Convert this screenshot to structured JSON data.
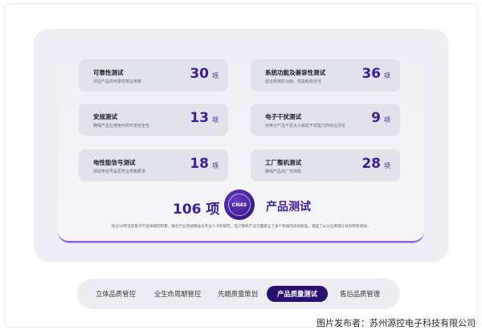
{
  "cards": [
    {
      "title": "可靠性测试",
      "desc": "评估产品的可靠性特征参数",
      "count": "30",
      "unit": "项"
    },
    {
      "title": "系统功能及兼容性测试",
      "desc": "验证系统的功能、性能和稳定性",
      "count": "36",
      "unit": "项"
    },
    {
      "title": "安规测试",
      "desc": "确保产品在使用中的环境安全性",
      "count": "13",
      "unit": "项"
    },
    {
      "title": "电子干扰测试",
      "desc": "对电子产品干扰大小和抗干扰能力的综合评定",
      "count": "9",
      "unit": "项"
    },
    {
      "title": "电性能信号测试",
      "desc": "测试电信号是否符合规格要求",
      "count": "18",
      "unit": "项"
    },
    {
      "title": "工厂整机测试",
      "desc": "确保产品出厂无缺陷",
      "count": "28",
      "unit": "项"
    }
  ],
  "total": {
    "count": "106",
    "unit": "项"
  },
  "badge_text": "CNAS",
  "section_title": "产品测试",
  "summary": "经过10年在各电子产品领域的积累，联合行业测试精益与专业人才的研究，在计算机产业方面建立了多个权威的测试标准，涵盖了从认证到电信号的所有测试。",
  "tabs": [
    "立体品质管控",
    "全生命周期管控",
    "先期质量策划",
    "产品质量测试",
    "售后品质管理"
  ],
  "active_tab": "产品质量测试",
  "credit": "图片发布者：苏州源控电子科技有限公司",
  "colors": {
    "accent": "#3d1d9e",
    "active_tab_bg": "#2a1070",
    "underline": "#8a63e6"
  }
}
